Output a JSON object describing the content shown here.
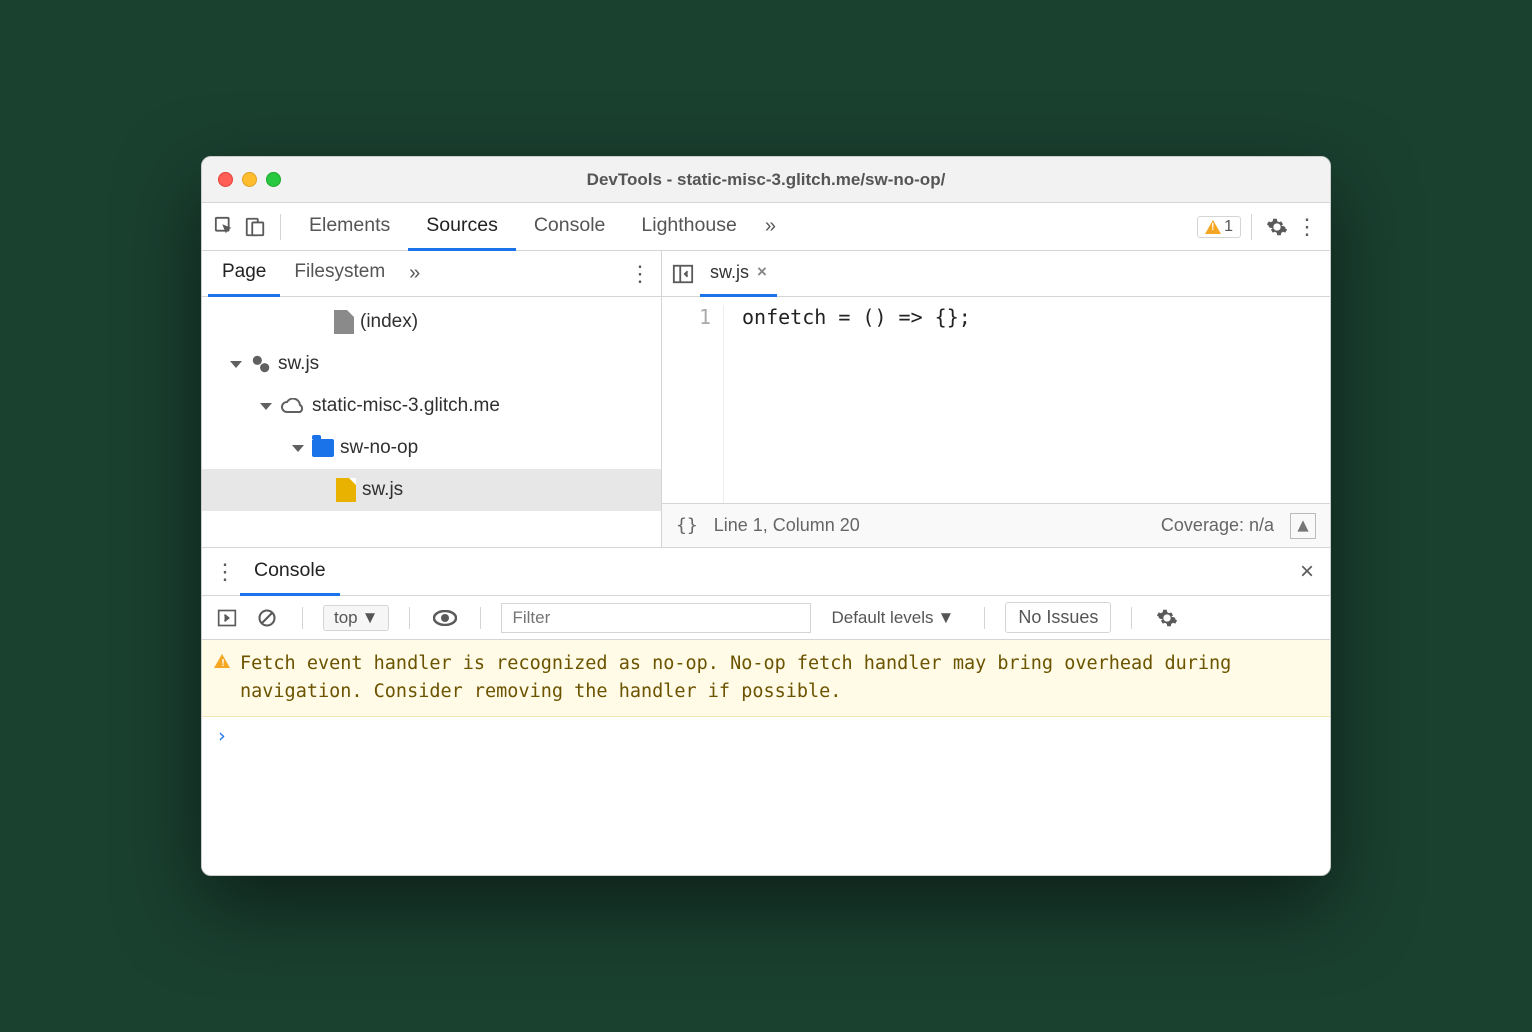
{
  "title": "DevTools - static-misc-3.glitch.me/sw-no-op/",
  "warningCount": "1",
  "topTabs": {
    "elements": "Elements",
    "sources": "Sources",
    "console": "Console",
    "lighthouse": "Lighthouse"
  },
  "navTabs": {
    "page": "Page",
    "filesystem": "Filesystem"
  },
  "tree": {
    "index": "(index)",
    "swjs_worker": "sw.js",
    "domain": "static-misc-3.glitch.me",
    "folder": "sw-no-op",
    "file": "sw.js"
  },
  "editor": {
    "filename": "sw.js",
    "lineNumber": "1",
    "code": "onfetch = () => {};"
  },
  "status": {
    "cursor": "Line 1, Column 20",
    "coverage": "Coverage: n/a",
    "pretty": "{}"
  },
  "drawer": {
    "tab": "Console"
  },
  "consoleToolbar": {
    "context": "top",
    "filterPlaceholder": "Filter",
    "levels": "Default levels",
    "issues": "No Issues"
  },
  "warningMessage": "Fetch event handler is recognized as no-op. No-op fetch handler may bring overhead during navigation. Consider removing the handler if possible.",
  "prompt": "›"
}
